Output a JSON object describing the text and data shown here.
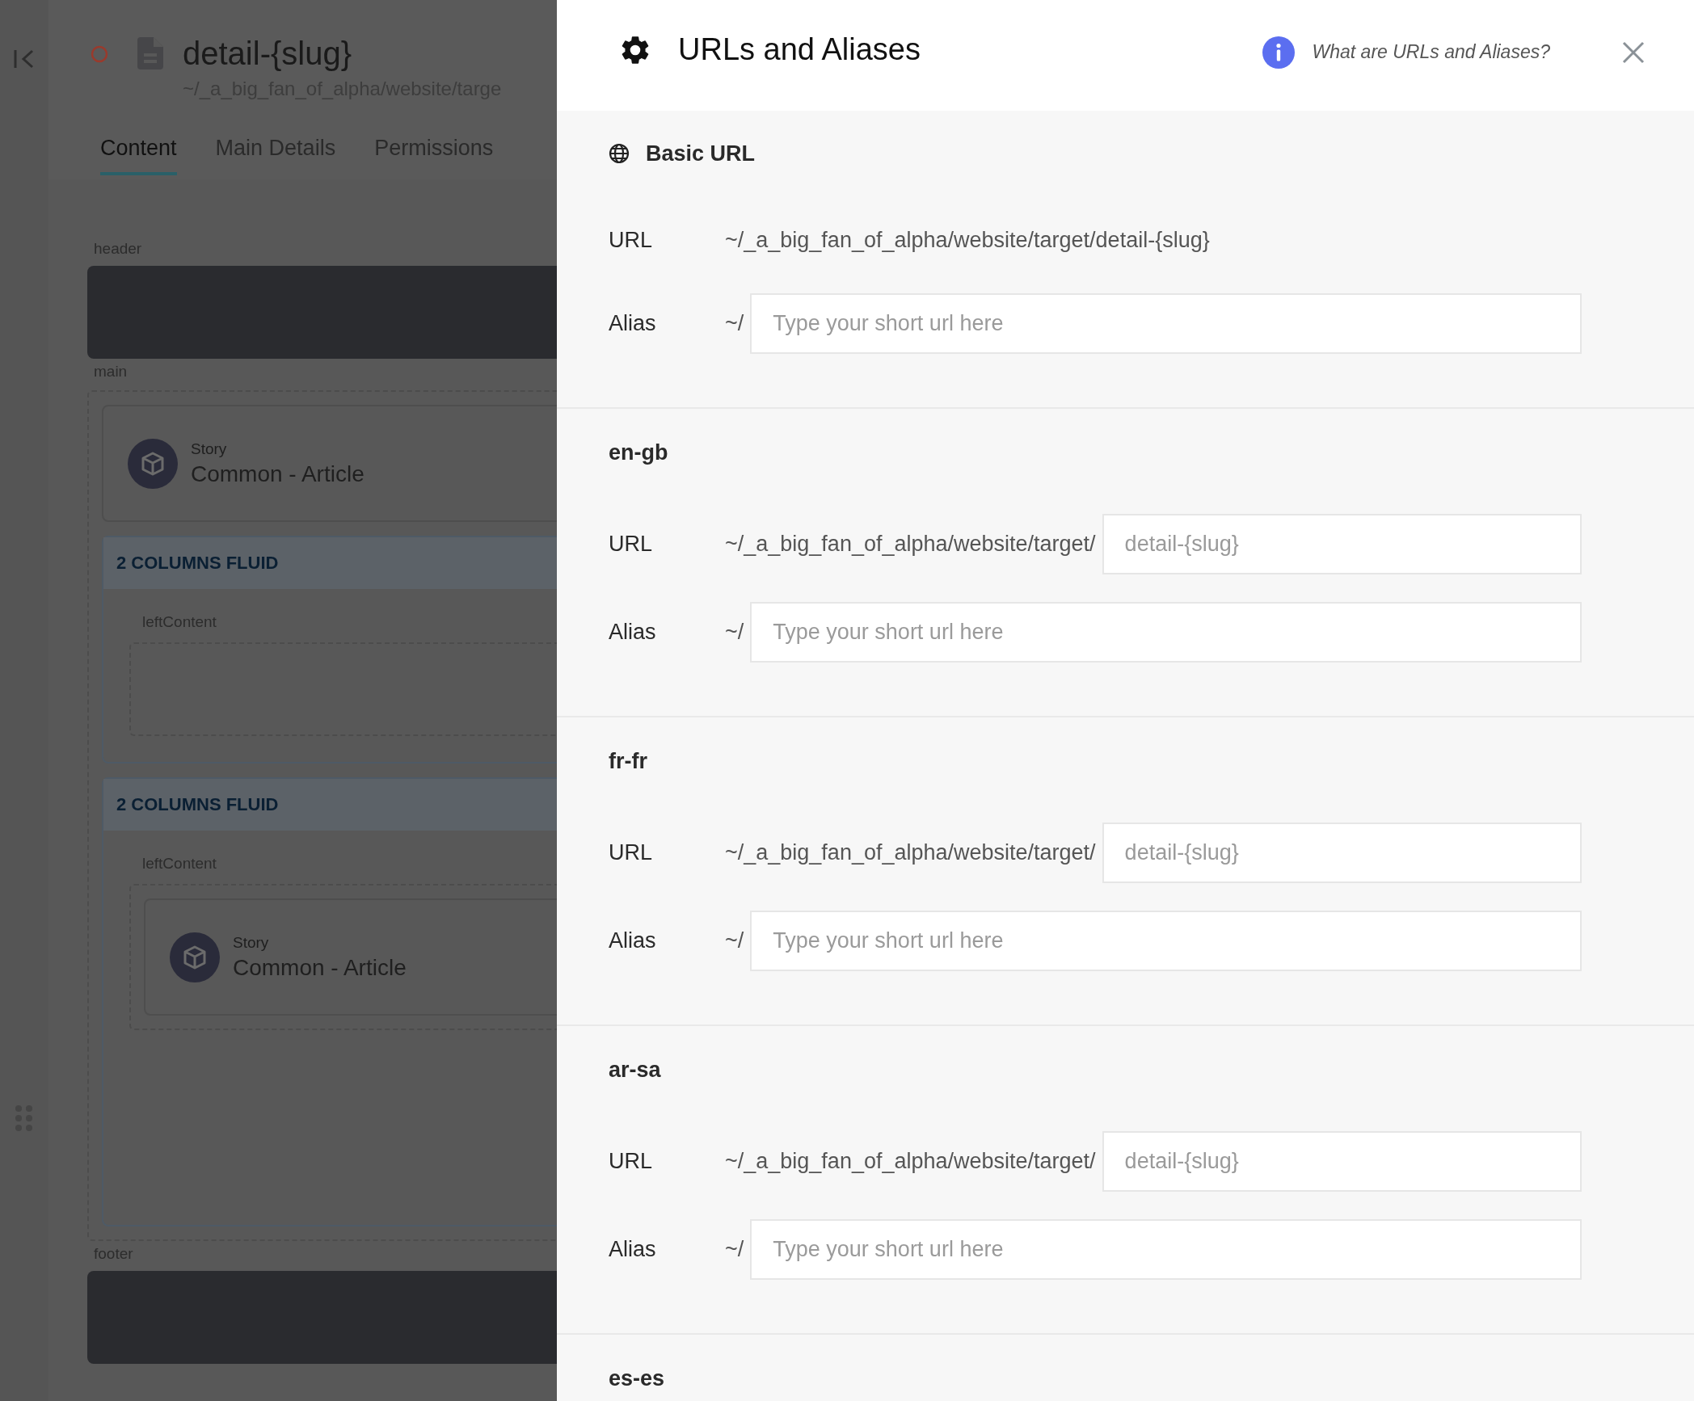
{
  "page": {
    "title": "detail-{slug}",
    "path": "~/_a_big_fan_of_alpha/website/targe"
  },
  "tabs": [
    {
      "label": "Content",
      "selected": true
    },
    {
      "label": "Main Details",
      "selected": false
    },
    {
      "label": "Permissions",
      "selected": false
    }
  ],
  "canvas": {
    "header": {
      "label": "header"
    },
    "main": {
      "label": "main",
      "items": [
        {
          "kind": "story",
          "type": "Story",
          "name": "Common - Article"
        },
        {
          "kind": "columns",
          "title": "2 COLUMNS FLUID",
          "slots": [
            {
              "label": "leftContent"
            }
          ]
        },
        {
          "kind": "columns",
          "title": "2 COLUMNS FLUID",
          "slots": [
            {
              "label": "leftContent",
              "items": [
                {
                  "kind": "story",
                  "type": "Story",
                  "name": "Common - Article"
                }
              ]
            }
          ]
        }
      ]
    },
    "footer": {
      "label": "footer"
    }
  },
  "dialog": {
    "title": "URLs and Aliases",
    "help_link": "What are URLs and Aliases?",
    "sections": [
      {
        "kind": "basic",
        "heading": "Basic URL",
        "url_label": "URL",
        "url": "~/_a_big_fan_of_alpha/website/target/detail-{slug}",
        "alias_label": "Alias",
        "alias_prefix": "~/",
        "alias_placeholder": "Type your short url here"
      },
      {
        "kind": "locale",
        "heading": "en-gb",
        "url_label": "URL",
        "url_prefix": "~/_a_big_fan_of_alpha/website/target/",
        "url_placeholder": "detail-{slug}",
        "alias_label": "Alias",
        "alias_prefix": "~/",
        "alias_placeholder": "Type your short url here"
      },
      {
        "kind": "locale",
        "heading": "fr-fr",
        "url_label": "URL",
        "url_prefix": "~/_a_big_fan_of_alpha/website/target/",
        "url_placeholder": "detail-{slug}",
        "alias_label": "Alias",
        "alias_prefix": "~/",
        "alias_placeholder": "Type your short url here"
      },
      {
        "kind": "locale",
        "heading": "ar-sa",
        "url_label": "URL",
        "url_prefix": "~/_a_big_fan_of_alpha/website/target/",
        "url_placeholder": "detail-{slug}",
        "alias_label": "Alias",
        "alias_prefix": "~/",
        "alias_placeholder": "Type your short url here"
      },
      {
        "kind": "locale",
        "heading": "es-es"
      }
    ]
  }
}
